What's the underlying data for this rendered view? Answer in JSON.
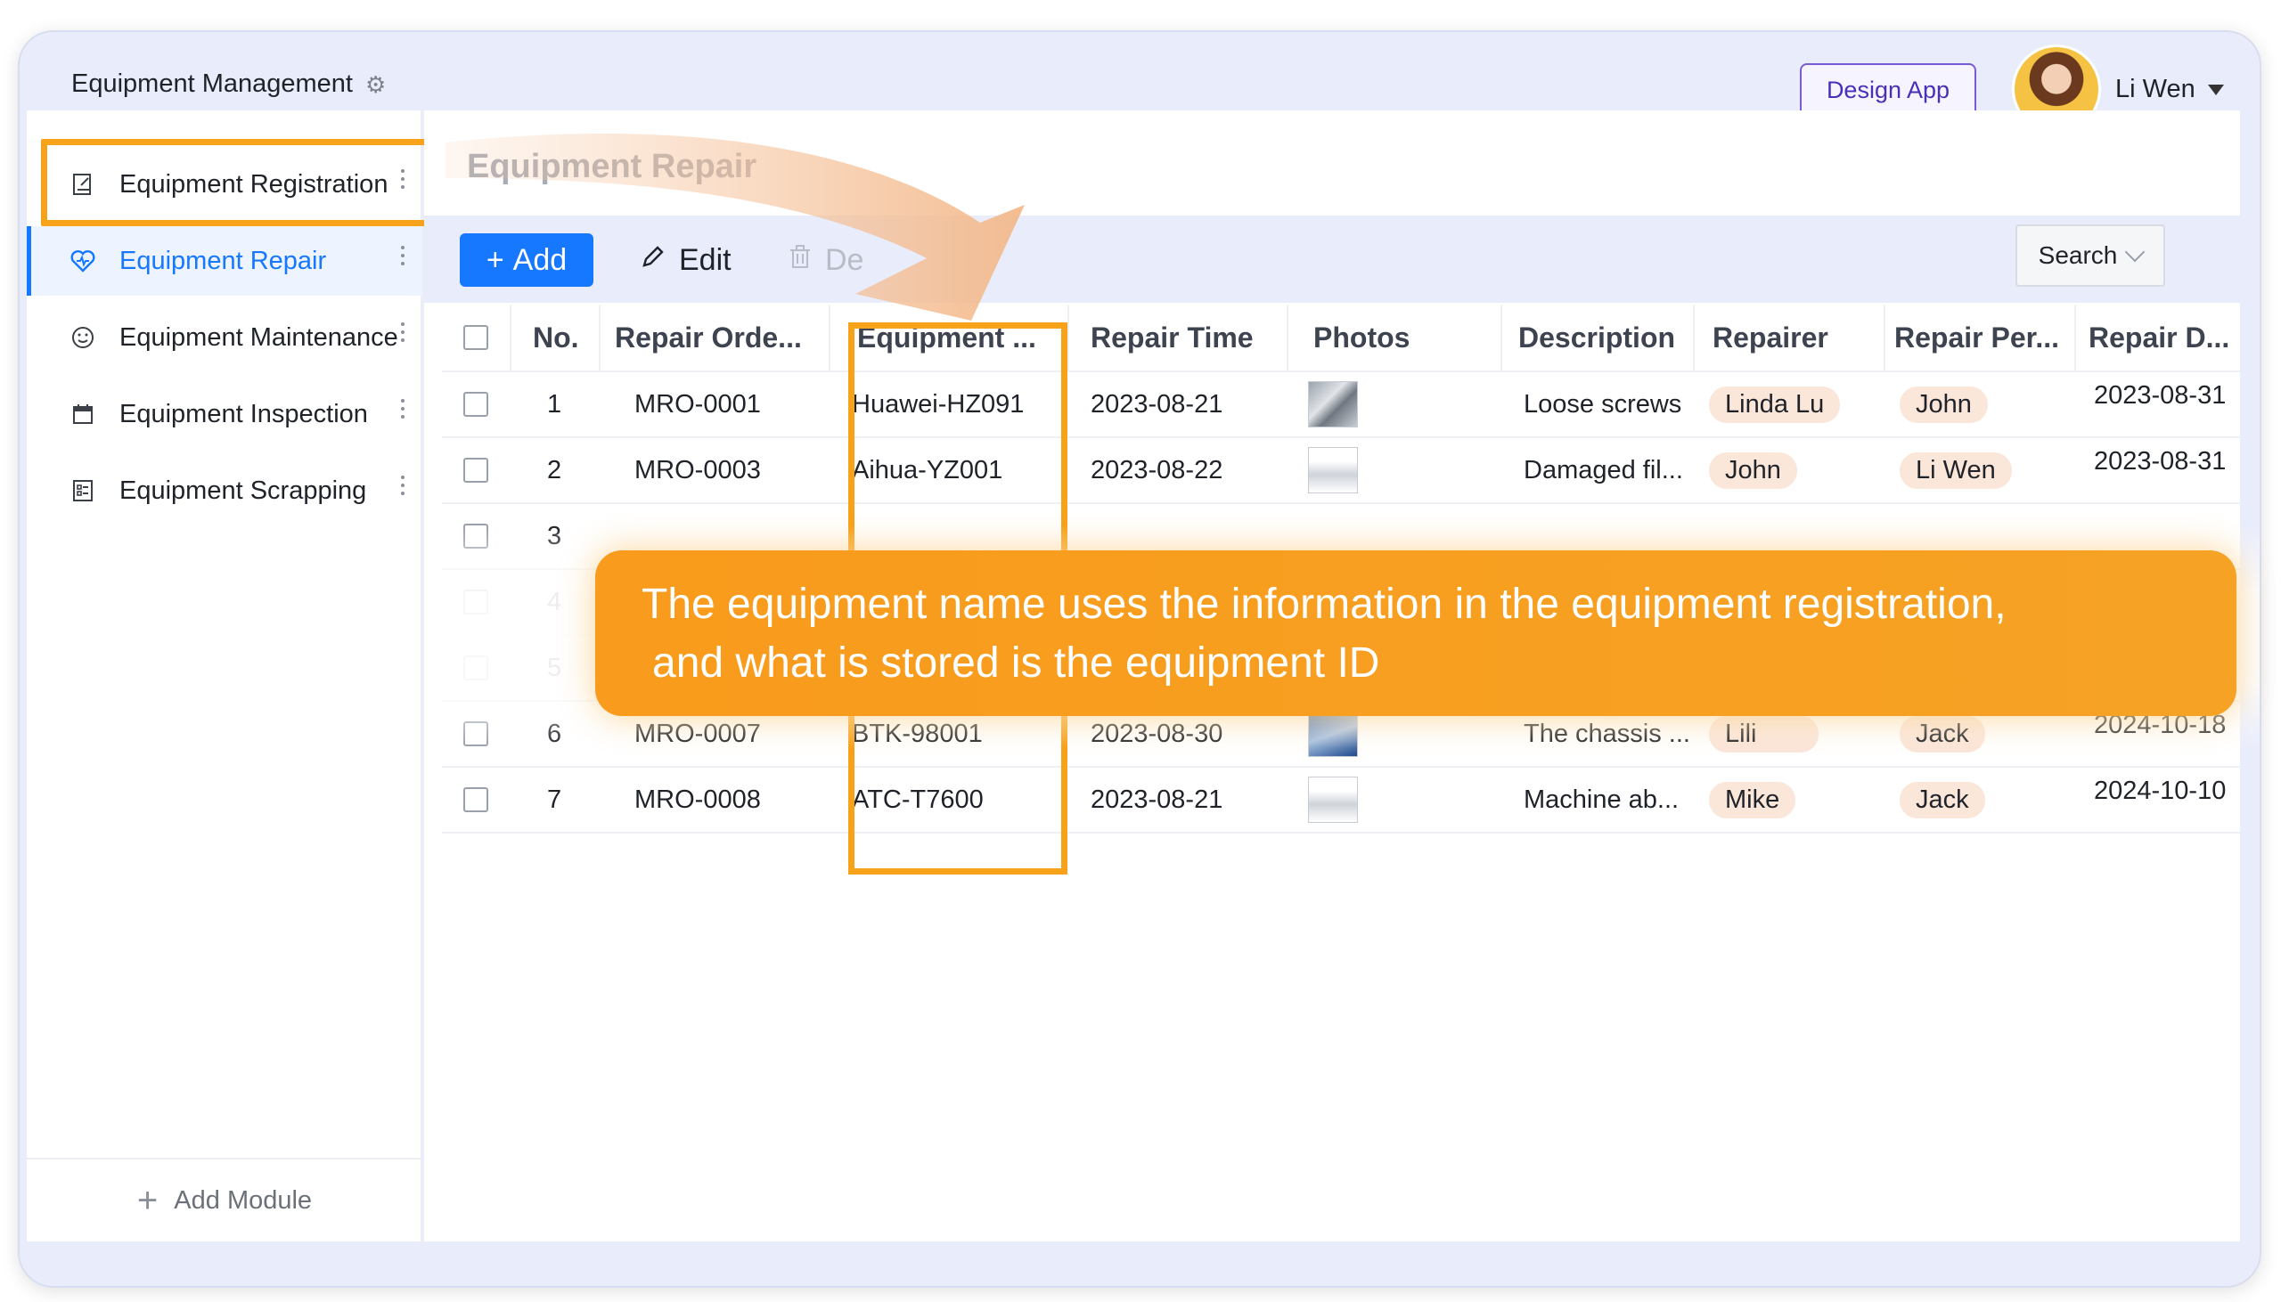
{
  "header": {
    "app_title": "Equipment Management",
    "design_button": "Design App",
    "user_name": "Li Wen"
  },
  "sidebar": {
    "items": [
      {
        "label": "Equipment Registration",
        "icon": "edit-doc-icon",
        "active": false
      },
      {
        "label": "Equipment Repair",
        "icon": "heart-repair-icon",
        "active": true
      },
      {
        "label": "Equipment Maintenance",
        "icon": "smiley-icon",
        "active": false
      },
      {
        "label": "Equipment Inspection",
        "icon": "calendar-icon",
        "active": false
      },
      {
        "label": "Equipment Scrapping",
        "icon": "form-list-icon",
        "active": false
      }
    ],
    "add_module": "Add Module"
  },
  "page": {
    "title": "Equipment Repair"
  },
  "toolbar": {
    "add_label": "Add",
    "edit_label": "Edit",
    "delete_label": "De",
    "search_label": "Search"
  },
  "table": {
    "columns": [
      "No.",
      "Repair Orde...",
      "Equipment ...",
      "Repair Time",
      "Photos",
      "Description",
      "Repairer",
      "Repair Per...",
      "Repair D..."
    ],
    "rows": [
      {
        "no": "1",
        "order": "MRO-0001",
        "equipment": "Huawei-HZ091",
        "time": "2023-08-21",
        "desc": "Loose screws",
        "repairer": "Linda Lu",
        "person": "John",
        "date": "2023-08-31"
      },
      {
        "no": "2",
        "order": "MRO-0003",
        "equipment": "Aihua-YZ001",
        "time": "2023-08-22",
        "desc": "Damaged fil...",
        "repairer": "John",
        "person": "Li Wen",
        "date": "2023-08-31"
      },
      {
        "no": "3",
        "order": "",
        "equipment": "",
        "time": "",
        "desc": "",
        "repairer": "",
        "person": "",
        "date": ""
      },
      {
        "no": "4",
        "order": "",
        "equipment": "",
        "time": "",
        "desc": "",
        "repairer": "",
        "person": "",
        "date": ""
      },
      {
        "no": "5",
        "order": "",
        "equipment": "",
        "time": "",
        "desc": "",
        "repairer": "",
        "person": "",
        "date": ""
      },
      {
        "no": "6",
        "order": "MRO-0007",
        "equipment": "BTK-98001",
        "time": "2023-08-30",
        "desc": "The chassis ...",
        "repairer": "Lili",
        "person": "Jack",
        "date": "2024-10-18"
      },
      {
        "no": "7",
        "order": "MRO-0008",
        "equipment": "ATC-T7600",
        "time": "2023-08-21",
        "desc": "Machine ab...",
        "repairer": "Mike",
        "person": "Jack",
        "date": "2024-10-10"
      }
    ]
  },
  "callout": {
    "line1": "The equipment name uses the information in the equipment registration,",
    "line2": "and what is stored is the equipment ID"
  },
  "colors": {
    "accent": "#1677ff",
    "highlight": "#f7a21b",
    "tag": "#fbe6da"
  }
}
